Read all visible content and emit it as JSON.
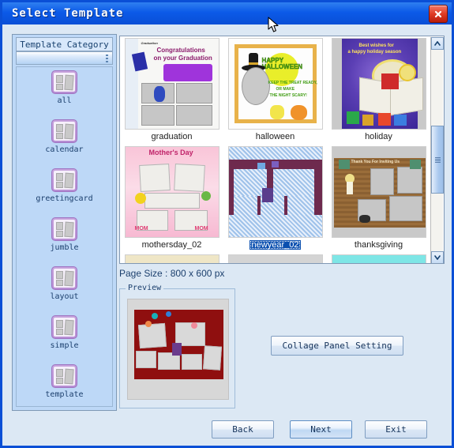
{
  "window": {
    "title": "Select Template",
    "close_icon": "close-icon"
  },
  "sidebar": {
    "title": "Template Category",
    "combo_value": "",
    "items": [
      {
        "label": "all",
        "icon": "template-thumb-icon"
      },
      {
        "label": "calendar",
        "icon": "template-thumb-icon"
      },
      {
        "label": "greetingcard",
        "icon": "template-thumb-icon"
      },
      {
        "label": "jumble",
        "icon": "template-thumb-icon"
      },
      {
        "label": "layout",
        "icon": "template-thumb-icon"
      },
      {
        "label": "simple",
        "icon": "template-thumb-icon"
      },
      {
        "label": "template",
        "icon": "template-thumb-icon"
      }
    ]
  },
  "grid": {
    "row1": [
      {
        "label": "graduation",
        "selected": false
      },
      {
        "label": "halloween",
        "selected": false
      },
      {
        "label": "holiday",
        "selected": false
      }
    ],
    "row2": [
      {
        "label": "mothersday_02",
        "selected": false
      },
      {
        "label": "newyear_02",
        "selected": true
      },
      {
        "label": "thanksgiving",
        "selected": false
      }
    ],
    "art": {
      "graduation_line1": "Congratulations",
      "graduation_line2": "on your Graduation",
      "graduation_tag": "Graduation",
      "halloween_title": "HAPPY HALLOWEEN",
      "halloween_line1": "KEEP THE TREAT READY,",
      "halloween_line2": "OR MAKE",
      "halloween_line3": "THE NIGHT SCARY!",
      "holiday_line1": "Best wishes for",
      "holiday_line2": "a happy holiday season",
      "mothersday_title": "Mother's Day",
      "mothersday_badge_left": "MOM",
      "mothersday_badge_right": "MOM",
      "thanksgiving_title": "Thank You For Inviting Us"
    },
    "scrollbar": {
      "up_icon": "chevron-up-icon",
      "down_icon": "chevron-down-icon"
    }
  },
  "page_size": "Page Size : 800 x 600 px",
  "preview": {
    "label": "Preview"
  },
  "actions": {
    "collage_panel_setting": "Collage Panel Setting",
    "back": "Back",
    "next": "Next",
    "exit": "Exit"
  },
  "colors": {
    "titlebar": "#0b5ae8",
    "dialog_bg": "#dce8f4",
    "sidebar_bg": "#bdd8f7",
    "selection": "#0a4faf",
    "close_red": "#df3c25",
    "category_icon": "#b78ed4"
  }
}
